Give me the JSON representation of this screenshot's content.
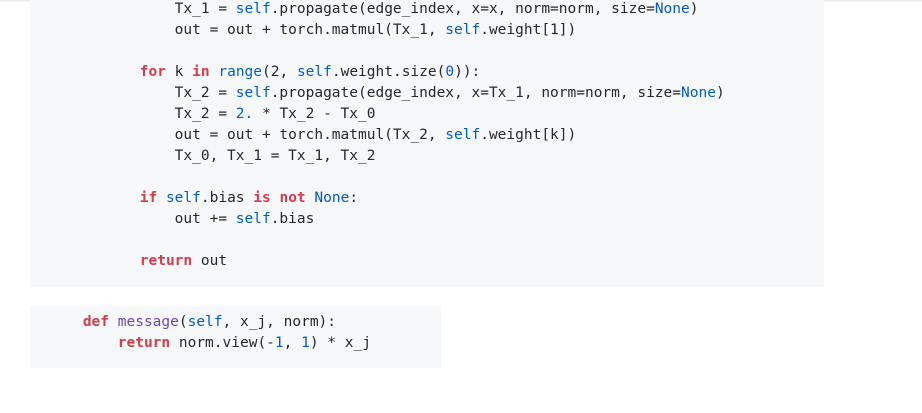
{
  "code_block_1": {
    "lines": [
      {
        "indent": 16,
        "tokens": [
          [
            "",
            "Tx_1 = "
          ],
          [
            "sf",
            "self"
          ],
          [
            "",
            ".propagate(edge_index, x=x, norm=norm, size="
          ],
          [
            "bi",
            "None"
          ],
          [
            "",
            ")"
          ]
        ]
      },
      {
        "indent": 16,
        "tokens": [
          [
            "",
            "out = out + torch.matmul(Tx_1, "
          ],
          [
            "sf",
            "self"
          ],
          [
            "",
            ".weight[1])"
          ]
        ]
      },
      {
        "indent": 12,
        "tokens": []
      },
      {
        "indent": 12,
        "tokens": [
          [
            "kw",
            "for"
          ],
          [
            "",
            " k "
          ],
          [
            "kw",
            "in"
          ],
          [
            "",
            " "
          ],
          [
            "bi",
            "range"
          ],
          [
            "",
            "(2, "
          ],
          [
            "sf",
            "self"
          ],
          [
            "",
            ".weight.size("
          ],
          [
            "nm",
            "0"
          ],
          [
            "",
            ")):"
          ]
        ]
      },
      {
        "indent": 16,
        "tokens": [
          [
            "",
            "Tx_2 = "
          ],
          [
            "sf",
            "self"
          ],
          [
            "",
            ".propagate(edge_index, x=Tx_1, norm=norm, size="
          ],
          [
            "bi",
            "None"
          ],
          [
            "",
            ")"
          ]
        ]
      },
      {
        "indent": 16,
        "tokens": [
          [
            "",
            "Tx_2 = "
          ],
          [
            "nm",
            "2."
          ],
          [
            "",
            " * Tx_2 - Tx_0"
          ]
        ]
      },
      {
        "indent": 16,
        "tokens": [
          [
            "",
            "out = out + torch.matmul(Tx_2, "
          ],
          [
            "sf",
            "self"
          ],
          [
            "",
            ".weight[k])"
          ]
        ]
      },
      {
        "indent": 16,
        "tokens": [
          [
            "",
            "Tx_0, Tx_1 = Tx_1, Tx_2"
          ]
        ]
      },
      {
        "indent": 12,
        "tokens": []
      },
      {
        "indent": 12,
        "tokens": [
          [
            "kw",
            "if"
          ],
          [
            "",
            " "
          ],
          [
            "sf",
            "self"
          ],
          [
            "",
            ".bias "
          ],
          [
            "kw",
            "is"
          ],
          [
            "",
            " "
          ],
          [
            "kw",
            "not"
          ],
          [
            "",
            " "
          ],
          [
            "bi",
            "None"
          ],
          [
            "",
            ":"
          ]
        ]
      },
      {
        "indent": 16,
        "tokens": [
          [
            "",
            "out += "
          ],
          [
            "sf",
            "self"
          ],
          [
            "",
            ".bias"
          ]
        ]
      },
      {
        "indent": 12,
        "tokens": []
      },
      {
        "indent": 12,
        "tokens": [
          [
            "kw",
            "return"
          ],
          [
            "",
            " out"
          ]
        ]
      }
    ]
  },
  "code_block_2": {
    "lines": [
      {
        "indent": 8,
        "tokens": [
          [
            "kw",
            "def"
          ],
          [
            "",
            " "
          ],
          [
            "fn",
            "message"
          ],
          [
            "",
            "("
          ],
          [
            "sf",
            "self"
          ],
          [
            "",
            ", x_j, norm):"
          ]
        ]
      },
      {
        "indent": 12,
        "tokens": [
          [
            "kw",
            "return"
          ],
          [
            "",
            " norm.view(-"
          ],
          [
            "nm",
            "1"
          ],
          [
            "",
            ", "
          ],
          [
            "nm",
            "1"
          ],
          [
            "",
            ") * x_j"
          ]
        ]
      }
    ]
  }
}
